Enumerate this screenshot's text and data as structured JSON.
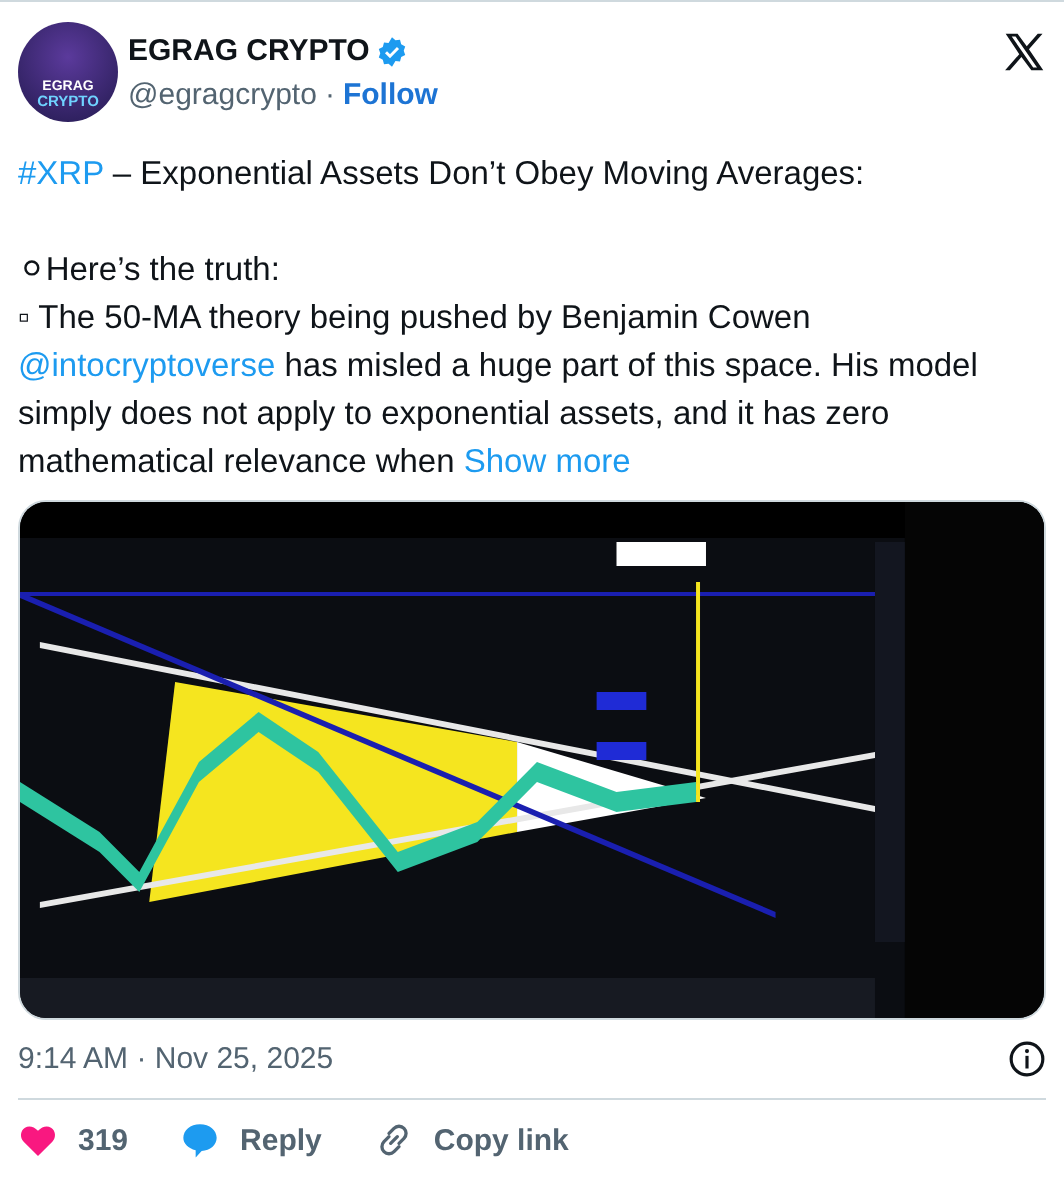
{
  "author": {
    "name": "EGRAG CRYPTO",
    "verified": true,
    "handle": "@egragcrypto",
    "separator": "·",
    "follow": "Follow",
    "avatar_text": [
      "EGRAG",
      "CRYPTO"
    ]
  },
  "paragraphs": [
    {
      "lines": [
        [
          {
            "kind": "link",
            "text": "#XRP"
          },
          {
            "kind": "text",
            "text": " – Exponential Assets Don’t Obey Moving Averages:"
          }
        ]
      ]
    },
    {
      "lines": [
        [
          {
            "kind": "text",
            "text": "⚪Here’s the truth:"
          }
        ],
        [
          {
            "kind": "text",
            "text": "▫ The 50-MA theory being pushed by Benjamin Cowen "
          },
          {
            "kind": "link",
            "text": "@intocryptoverse"
          },
          {
            "kind": "text",
            "text": " has misled a huge part of this space. His model simply does not apply to exponential assets, and it has zero mathematical relevance when "
          },
          {
            "kind": "link",
            "text": "Show more"
          }
        ]
      ]
    }
  ],
  "timestamp": "9:14 AM · Nov 25, 2025",
  "actions": [
    {
      "kind": "like",
      "label": "319"
    },
    {
      "kind": "reply",
      "label": "Reply"
    },
    {
      "kind": "copy",
      "label": "Copy link"
    }
  ]
}
